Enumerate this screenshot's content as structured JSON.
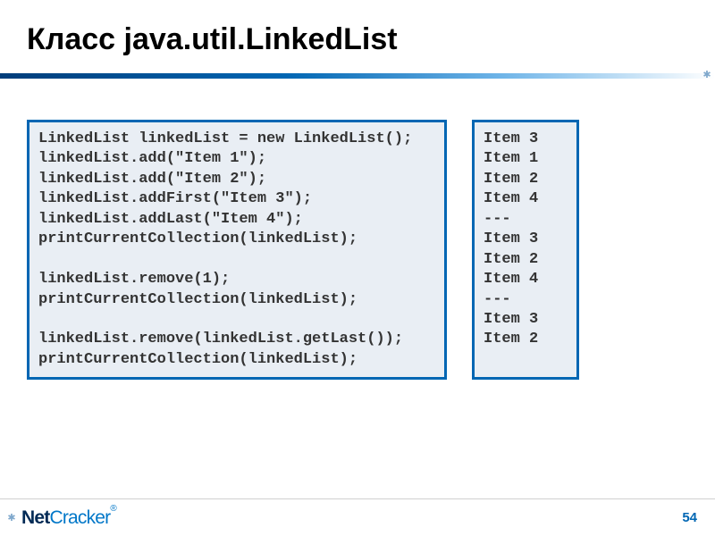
{
  "title": "Класс java.util.LinkedList",
  "code": "LinkedList linkedList = new LinkedList();\nlinkedList.add(\"Item 1\");\nlinkedList.add(\"Item 2\");\nlinkedList.addFirst(\"Item 3\");\nlinkedList.addLast(\"Item 4\");\nprintCurrentCollection(linkedList);\n\nlinkedList.remove(1);\nprintCurrentCollection(linkedList);\n\nlinkedList.remove(linkedList.getLast());\nprintCurrentCollection(linkedList);",
  "output": "Item 3\nItem 1\nItem 2\nItem 4\n---\nItem 3\nItem 2\nItem 4\n---\nItem 3\nItem 2",
  "logo": {
    "part1": "Net",
    "part2": "Cracker",
    "reg": "®"
  },
  "page_number": "54"
}
